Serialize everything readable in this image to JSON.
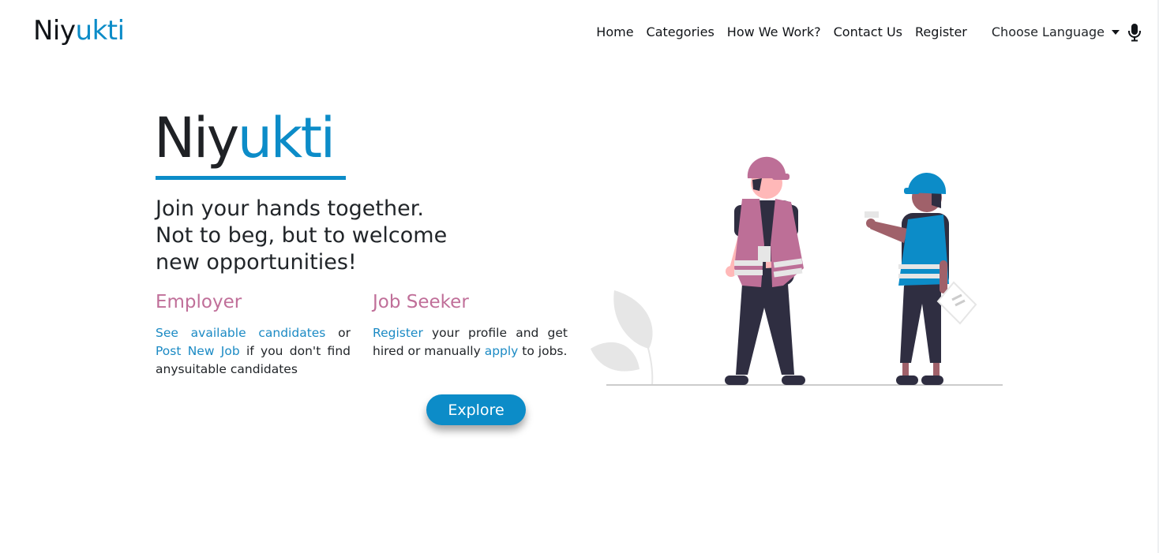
{
  "navbar": {
    "brand": {
      "part1": "Niy",
      "part2": "ukti"
    },
    "links": [
      "Home",
      "Categories",
      "How We Work?",
      "Contact Us",
      "Register"
    ],
    "language_label": "Choose Language"
  },
  "hero": {
    "title_part1": "Niy",
    "title_part2": "ukti",
    "tagline_lines": [
      "Join your hands together.",
      "Not to beg, but to welcome",
      "new opportunities!"
    ]
  },
  "employer": {
    "heading": "Employer",
    "link1": "See available candidates",
    "text1": " or ",
    "link2": "Post New Job",
    "text2": " if you don't find anysuitable candidates"
  },
  "seeker": {
    "heading": "Job Seeker",
    "link1": "Register",
    "text1": " your profile and get hired or manually ",
    "link2": "apply",
    "text2": " to jobs."
  },
  "explore_label": "Explore",
  "icons": {
    "language": "caret-down-icon",
    "voice": "microphone-icon"
  },
  "colors": {
    "brand_blue": "#0c8cc8",
    "accent_pink": "#c06f99",
    "text_dark": "#212529"
  }
}
